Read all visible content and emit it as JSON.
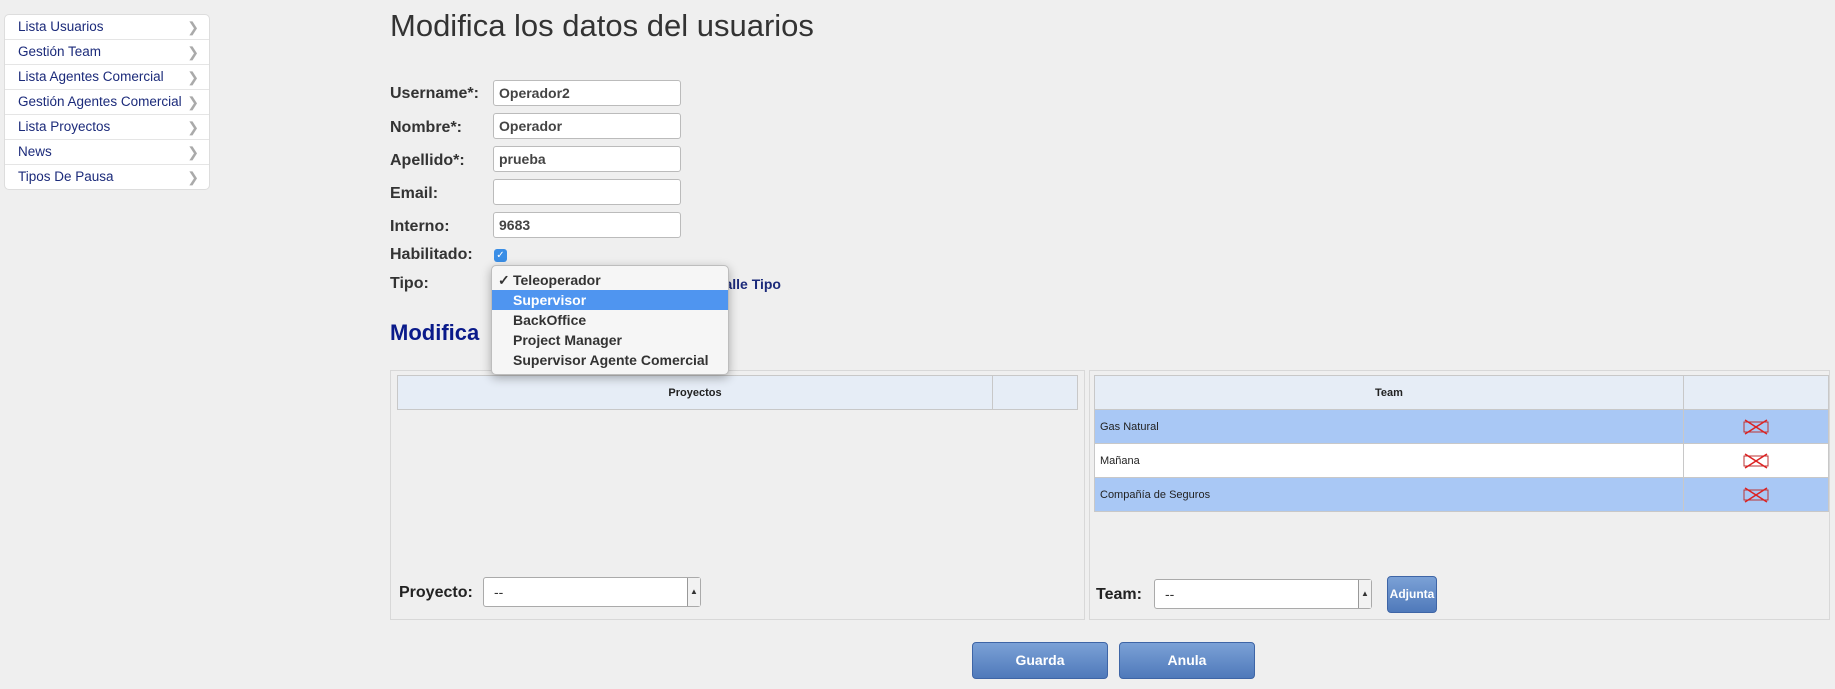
{
  "sidebar": {
    "items": [
      {
        "label": "Lista Usuarios"
      },
      {
        "label": "Gestión Team"
      },
      {
        "label": "Lista Agentes Comercial"
      },
      {
        "label": "Gestión Agentes Comercial"
      },
      {
        "label": "Lista Proyectos"
      },
      {
        "label": "News"
      },
      {
        "label": "Tipos De Pausa"
      }
    ]
  },
  "page": {
    "title": "Modifica los datos del usuarios",
    "section_title": "Modifica"
  },
  "form": {
    "username": {
      "label": "Username*:",
      "value": "Operador2"
    },
    "nombre": {
      "label": "Nombre*:",
      "value": "Operador"
    },
    "apellido": {
      "label": "Apellido*:",
      "value": "prueba"
    },
    "email": {
      "label": "Email:",
      "value": ""
    },
    "interno": {
      "label": "Interno:",
      "value": "9683"
    },
    "habilitado": {
      "label": "Habilitado:",
      "checked": true
    },
    "tipo": {
      "label": "Tipo:",
      "detalle_link": "etalle Tipo"
    }
  },
  "tipo_dropdown": {
    "options": [
      {
        "label": "Teleoperador",
        "checked": true
      },
      {
        "label": "Supervisor",
        "highlighted": true
      },
      {
        "label": "BackOffice"
      },
      {
        "label": "Project Manager"
      },
      {
        "label": "Supervisor Agente Comercial"
      }
    ]
  },
  "proyectos_panel": {
    "header": "Proyectos",
    "select_label": "Proyecto:",
    "select_value": "--"
  },
  "team_panel": {
    "header": "Team",
    "rows": [
      {
        "name": "Gas Natural"
      },
      {
        "name": "Mañana"
      },
      {
        "name": "Compañía de Seguros"
      }
    ],
    "select_label": "Team:",
    "select_value": "--",
    "adjunta_label": "Adjunta"
  },
  "actions": {
    "guarda_label": "Guarda",
    "anula_label": "Anula"
  },
  "colors": {
    "link": "#1b2a7a",
    "section_title": "#0a1a8a",
    "row_highlight": "#a9c8f5",
    "dropdown_selected": "#4f95f0",
    "button_blue": "#4f79ba"
  }
}
